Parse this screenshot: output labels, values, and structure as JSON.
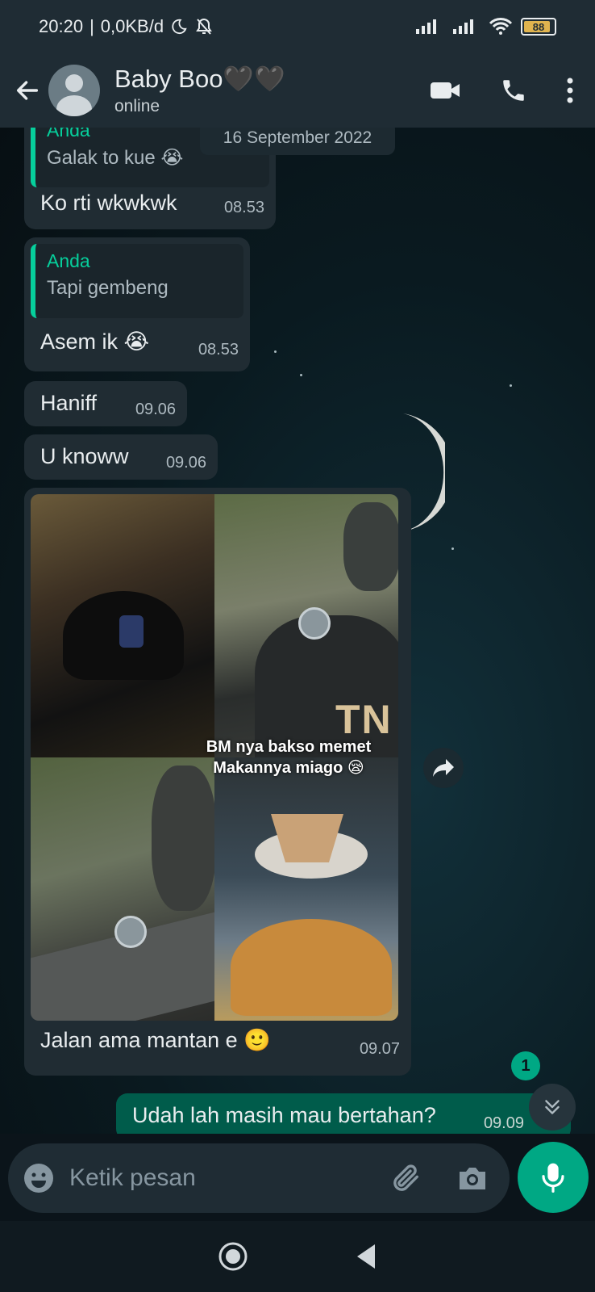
{
  "status_bar": {
    "time": "20:20",
    "network_speed": "0,0KB/d",
    "battery": "88",
    "battery_level": 0.88
  },
  "header": {
    "contact_name": "Baby Boo🖤🖤",
    "contact_status": "online"
  },
  "chat": {
    "date_chip": "16 September 2022",
    "messages": [
      {
        "quote_author": "Anda",
        "quote_text": "Galak to kue 😭",
        "text": "Ko rti wkwkwk",
        "time": "08.53"
      },
      {
        "quote_author": "Anda",
        "quote_text": "Tapi gembeng",
        "text": "Asem ik 😭",
        "time": "08.53"
      },
      {
        "text": "Haniff",
        "time": "09.06"
      },
      {
        "text": "U knoww",
        "time": "09.06"
      },
      {
        "image_overlay_line1": "BM nya bakso memet",
        "image_overlay_line2": "Makannya miago 😪",
        "image_shirt_text": "TN",
        "text": "Jalan ama mantan e 🙂",
        "time": "09.07"
      }
    ],
    "outgoing": {
      "text": "Udah lah masih mau bertahan?",
      "time": "09.09"
    },
    "unread_count": "1"
  },
  "composer": {
    "placeholder": "Ketik pesan"
  },
  "icons": {
    "back": "arrow-left-icon",
    "video": "video-call-icon",
    "call": "phone-icon",
    "menu": "more-vert-icon",
    "emoji": "emoji-icon",
    "attach": "paperclip-icon",
    "camera": "camera-icon",
    "mic": "mic-icon",
    "forward": "forward-icon",
    "scroll_down": "double-chevron-down-icon"
  },
  "colors": {
    "accent": "#00a884",
    "outgoing_bubble": "#005c4b",
    "incoming_bubble": "#202c33",
    "quote_author": "#06cf9c"
  }
}
